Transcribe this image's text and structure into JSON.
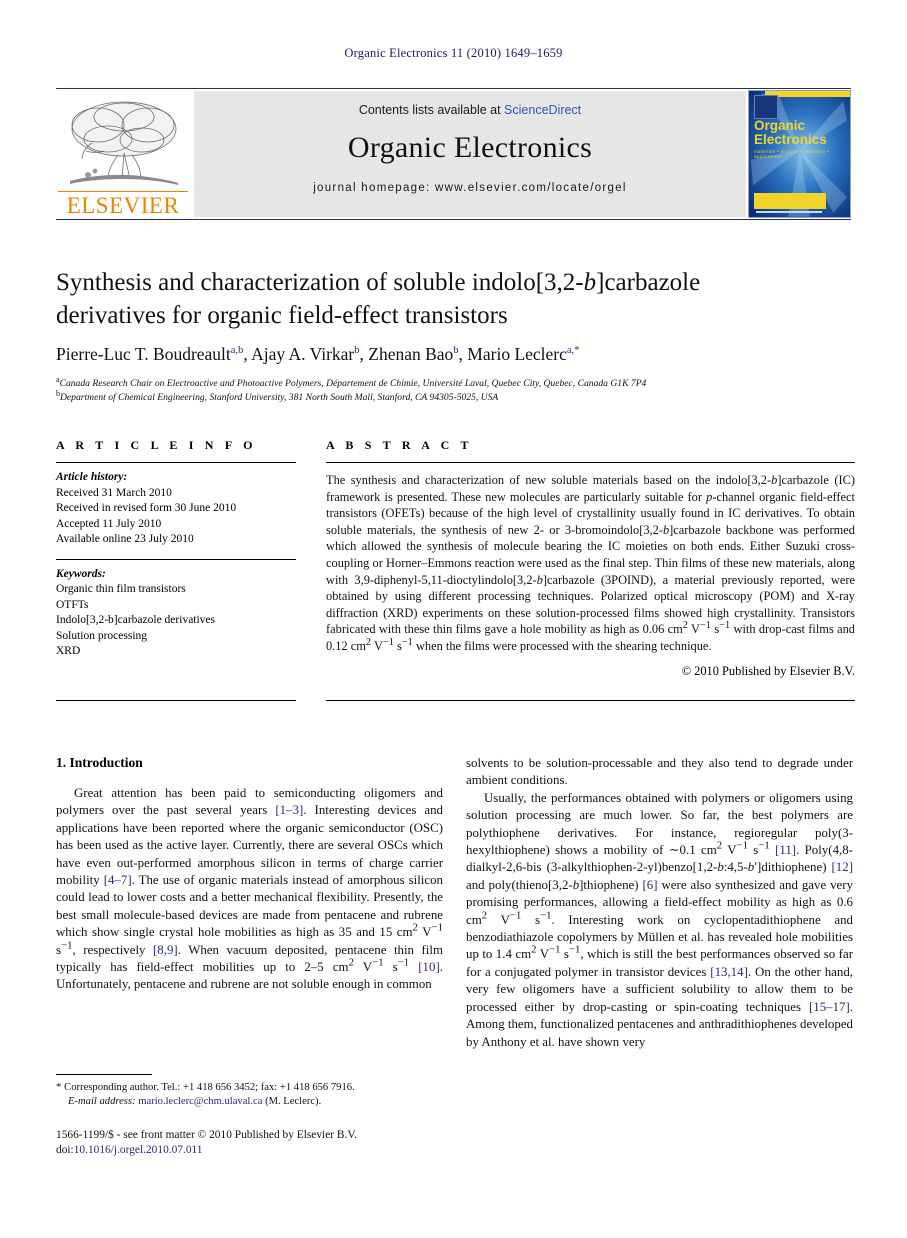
{
  "running_head": "Organic Electronics 11 (2010) 1649–1659",
  "masthead": {
    "contents_prefix": "Contents lists available at ",
    "sciencedirect": "ScienceDirect",
    "journal_name": "Organic Electronics",
    "homepage": "journal homepage: www.elsevier.com/locate/orgel",
    "publisher_logo_text": "ELSEVIER",
    "publisher_logo_icon": "elsevier-tree-logo",
    "cover": {
      "title_line1": "Organic",
      "title_line2": "Electronics",
      "subtitle": "materials • physics • chemistry • applications"
    },
    "colors": {
      "elsevier_orange": "#f08000",
      "sciencedirect_blue": "#2b55b7",
      "masthead_band": "#e6e6e6",
      "cover_blue": "#0b3f8f",
      "cover_yellow": "#f2d32a",
      "rule_navy": "#2b2b6b"
    }
  },
  "article": {
    "title_line1": "Synthesis and characterization of soluble indolo[3,2-",
    "title_italic1": "b",
    "title_line1b": "]carbazole",
    "title_line2": "derivatives for organic field-effect transistors",
    "authors": [
      {
        "name": "Pierre-Luc T. Boudreault",
        "marks": "a,b",
        "sep": ", "
      },
      {
        "name": "Ajay A. Virkar",
        "marks": "b",
        "sep": ", "
      },
      {
        "name": "Zhenan Bao",
        "marks": "b",
        "sep": ", "
      },
      {
        "name": "Mario Leclerc",
        "marks": "a,",
        "mark_star": "*",
        "sep": ""
      }
    ],
    "affiliations": [
      {
        "mark": "a",
        "text": "Canada Research Chair on Electroactive and Photoactive Polymers, Département de Chimie, Université Laval, Quebec City, Quebec, Canada G1K 7P4"
      },
      {
        "mark": "b",
        "text": "Department of Chemical Engineering, Stanford University, 381 North South Mall, Stanford, CA 94305-5025, USA"
      }
    ]
  },
  "article_info": {
    "heading": "A R T I C L E   I N F O",
    "history_label": "Article history:",
    "history": [
      "Received 31 March 2010",
      "Received in revised form 30 June 2010",
      "Accepted 11 July 2010",
      "Available online 23 July 2010"
    ],
    "keywords_label": "Keywords:",
    "keywords": [
      "Organic thin film transistors",
      "OTFTs",
      "Indolo[3,2-b]carbazole derivatives",
      "Solution processing",
      "XRD"
    ]
  },
  "abstract": {
    "heading": "A B S T R A C T",
    "paragraph_html": "The synthesis and characterization of new soluble materials based on the indolo[3,2-<i>b</i>]carbazole (IC) framework is presented. These new molecules are particularly suitable for <i>p</i>-channel organic field-effect transistors (OFETs) because of the high level of crystallinity usually found in IC derivatives. To obtain soluble materials, the synthesis of new 2- or 3-bromoindolo[3,2-<i>b</i>]carbazole backbone was performed which allowed the synthesis of molecule bearing the IC moieties on both ends. Either Suzuki cross-coupling or Horner–Emmons reaction were used as the final step. Thin films of these new materials, along with 3,9-diphenyl-5,11-dioctylindolo[3,2-<i>b</i>]carbazole (3POIND), a material previously reported, were obtained by using different processing techniques. Polarized optical microscopy (POM) and X-ray diffraction (XRD) experiments on these solution-processed films showed high crystallinity. Transistors fabricated with these thin films gave a hole mobility as high as 0.06 cm<sup>2</sup> V<sup>−1</sup> s<sup>−1</sup> with drop-cast films and 0.12 cm<sup>2</sup> V<sup>−1</sup> s<sup>−1</sup> when the films were processed with the shearing technique.",
    "copyright": "© 2010 Published by Elsevier B.V."
  },
  "body": {
    "section1_title": "1. Introduction",
    "left_para1_html": "Great attention has been paid to semiconducting oligomers and polymers over the past several years <span class=\"ref\">[1–3]</span>. Interesting devices and applications have been reported where the organic semiconductor (OSC) has been used as the active layer. Currently, there are several OSCs which have even out-performed amorphous silicon in terms of charge carrier mobility <span class=\"ref\">[4–7]</span>. The use of organic materials instead of amorphous silicon could lead to lower costs and a better mechanical flexibility. Presently, the best small molecule-based devices are made from pentacene and rubrene which show single crystal hole mobilities as high as 35 and 15 cm<sup>2</sup> V<sup>−1</sup> s<sup>−1</sup>, respectively <span class=\"ref\">[8,9]</span>. When vacuum deposited, pentacene thin film typically has field-effect mobilities up to 2–5 cm<sup>2</sup> V<sup>−1</sup> s<sup>−1</sup> <span class=\"ref\">[10]</span>. Unfortunately, pentacene and rubrene are not soluble enough in common",
    "right_para1_html": "solvents to be solution-processable and they also tend to degrade under ambient conditions.",
    "right_para2_html": "Usually, the performances obtained with polymers or oligomers using solution processing are much lower. So far, the best polymers are polythiophene derivatives. For instance, regioregular poly(3-hexylthiophene) shows a mobility of ∼0.1 cm<sup>2</sup> V<sup>−1</sup> s<sup>−1</sup> <span class=\"ref\">[11]</span>. Poly(4,8-dialkyl-2,6-bis (3-alkylthiophen-2-yl)benzo[1,2-<i>b</i>:4,5-<i>b</i>′]dithiophene) <span class=\"ref\">[12]</span> and poly(thieno[3,2-<i>b</i>]thiophene) <span class=\"ref\">[6]</span> were also synthesized and gave very promising performances, allowing a field-effect mobility as high as 0.6 cm<sup>2</sup> V<sup>−1</sup> s<sup>−1</sup>. Interesting work on cyclopentadithiophene and benzodiathiazole copolymers by Müllen et al. has revealed hole mobilities up to 1.4 cm<sup>2</sup> V<sup>−1</sup> s<sup>−1</sup>, which is still the best performances observed so far for a conjugated polymer in transistor devices <span class=\"ref\">[13,14]</span>. On the other hand, very few oligomers have a sufficient solubility to allow them to be processed either by drop-casting or spin-coating techniques <span class=\"ref\">[15–17]</span>. Among them, functionalized pentacenes and anthradithiophenes developed by Anthony et al. have shown very"
  },
  "footnote": {
    "star": "*",
    "corresponding_html": "Corresponding author. Tel.: +1 418 656 3452; fax: +1 418 656 7916.",
    "email_label": "E-mail address:",
    "email": "mario.leclerc@chm.ulaval.ca",
    "email_suffix": "(M. Leclerc)."
  },
  "imprint": {
    "line1": "1566-1199/$ - see front matter © 2010 Published by Elsevier B.V.",
    "doi_label": "doi:",
    "doi": "10.1016/j.orgel.2010.07.011"
  }
}
